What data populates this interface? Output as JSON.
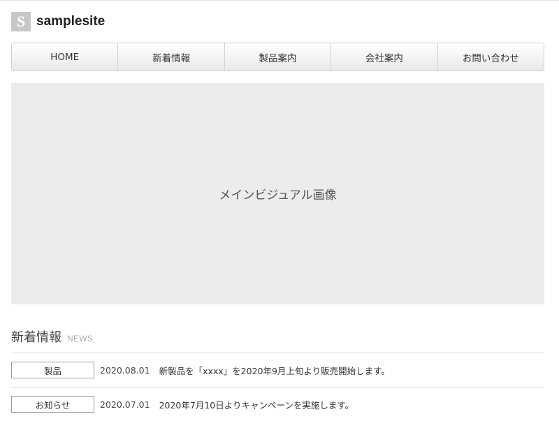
{
  "header": {
    "logo_letter": "S",
    "site_name": "samplesite"
  },
  "nav": {
    "items": [
      {
        "label": "HOME"
      },
      {
        "label": "新着情報"
      },
      {
        "label": "製品案内"
      },
      {
        "label": "会社案内"
      },
      {
        "label": "お問い合わせ"
      }
    ]
  },
  "hero": {
    "label": "メインビジュアル画像"
  },
  "news": {
    "title": "新着情報",
    "subtitle": "NEWS",
    "items": [
      {
        "category": "製品",
        "date": "2020.08.01",
        "text": "新製品を「xxxx」を2020年9月上旬より販売開始します。"
      },
      {
        "category": "お知らせ",
        "date": "2020.07.01",
        "text": "2020年7月10日よりキャンペーンを実施します。"
      }
    ]
  }
}
